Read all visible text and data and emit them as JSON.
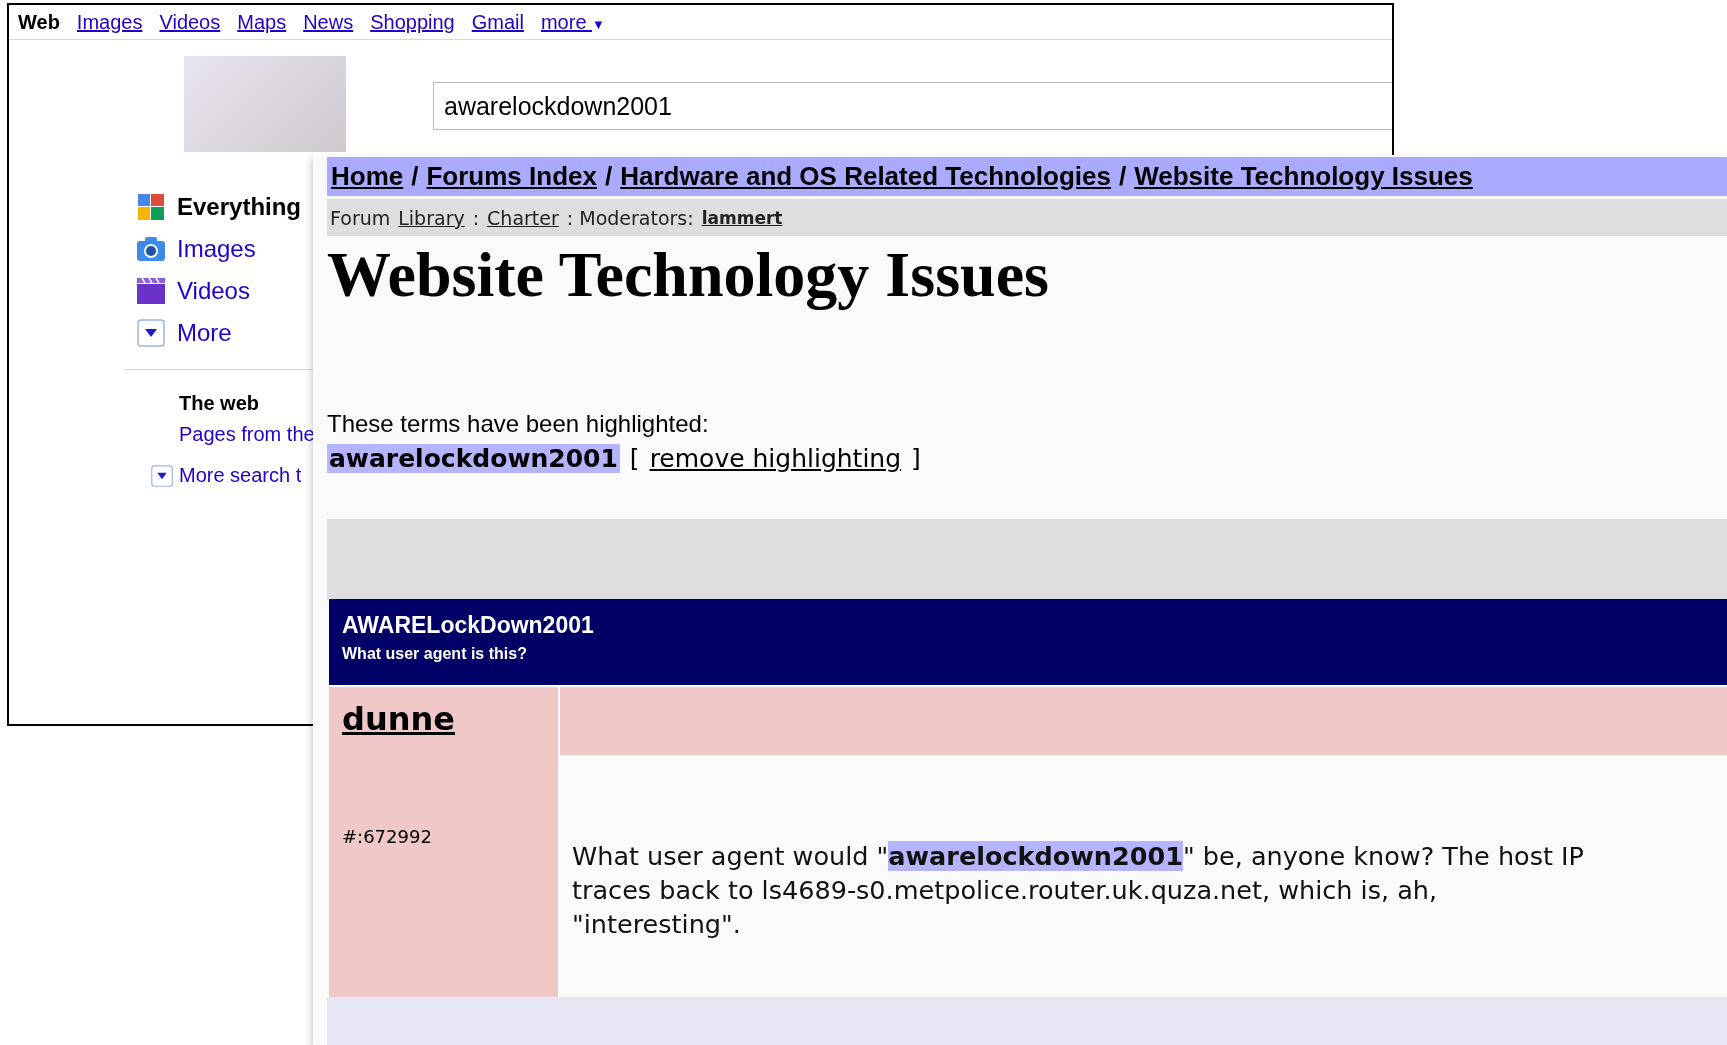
{
  "google_window": {
    "nav": [
      {
        "label": "Web",
        "selected": true
      },
      {
        "label": "Images",
        "selected": false
      },
      {
        "label": "Videos",
        "selected": false
      },
      {
        "label": "Maps",
        "selected": false
      },
      {
        "label": "News",
        "selected": false
      },
      {
        "label": "Shopping",
        "selected": false
      },
      {
        "label": "Gmail",
        "selected": false
      },
      {
        "label": "more",
        "selected": false
      }
    ],
    "more_caret": "▼",
    "search": {
      "value": "awarelockdown2001"
    },
    "sidebar": {
      "items": [
        {
          "label": "Everything",
          "kind": "everything",
          "selected": true
        },
        {
          "label": "Images",
          "kind": "images",
          "selected": false
        },
        {
          "label": "Videos",
          "kind": "videos",
          "selected": false
        },
        {
          "label": "More",
          "kind": "more",
          "selected": false
        }
      ],
      "section_heading": "The web",
      "section_link": "Pages from the",
      "more_tools": "More search t"
    }
  },
  "forum_window": {
    "breadcrumb": [
      "Home",
      "Forums Index",
      "Hardware and OS Related Technologies",
      "Website Technology Issues"
    ],
    "breadcrumb_separator": "/",
    "info_bar": [
      {
        "text": "Forum",
        "kind": "plain"
      },
      {
        "text": "Library",
        "kind": "link"
      },
      {
        "text": ":",
        "kind": "plain"
      },
      {
        "text": "Charter",
        "kind": "link"
      },
      {
        "text": ": Moderators:",
        "kind": "plain"
      },
      {
        "text": "lammert",
        "kind": "strong_link"
      }
    ],
    "title": "Website Technology Issues",
    "highlight_note": "These terms have been highlighted:",
    "highlighted_terms": [
      "awarelockdown2001"
    ],
    "remove_open": "[",
    "remove_link": "remove highlighting",
    "remove_close": "]",
    "thread": {
      "title": "AWARELockDown2001",
      "subtitle": "What user agent is this?"
    },
    "post": {
      "author": "dunne",
      "post_id": "#:672992",
      "body": "What user agent would \"**awarelockdown2001**\" be, anyone know? The host IP traces back to ls4689-s0.metpolice.router.uk.quza.net, which is, ah, \"interesting\"."
    }
  }
}
